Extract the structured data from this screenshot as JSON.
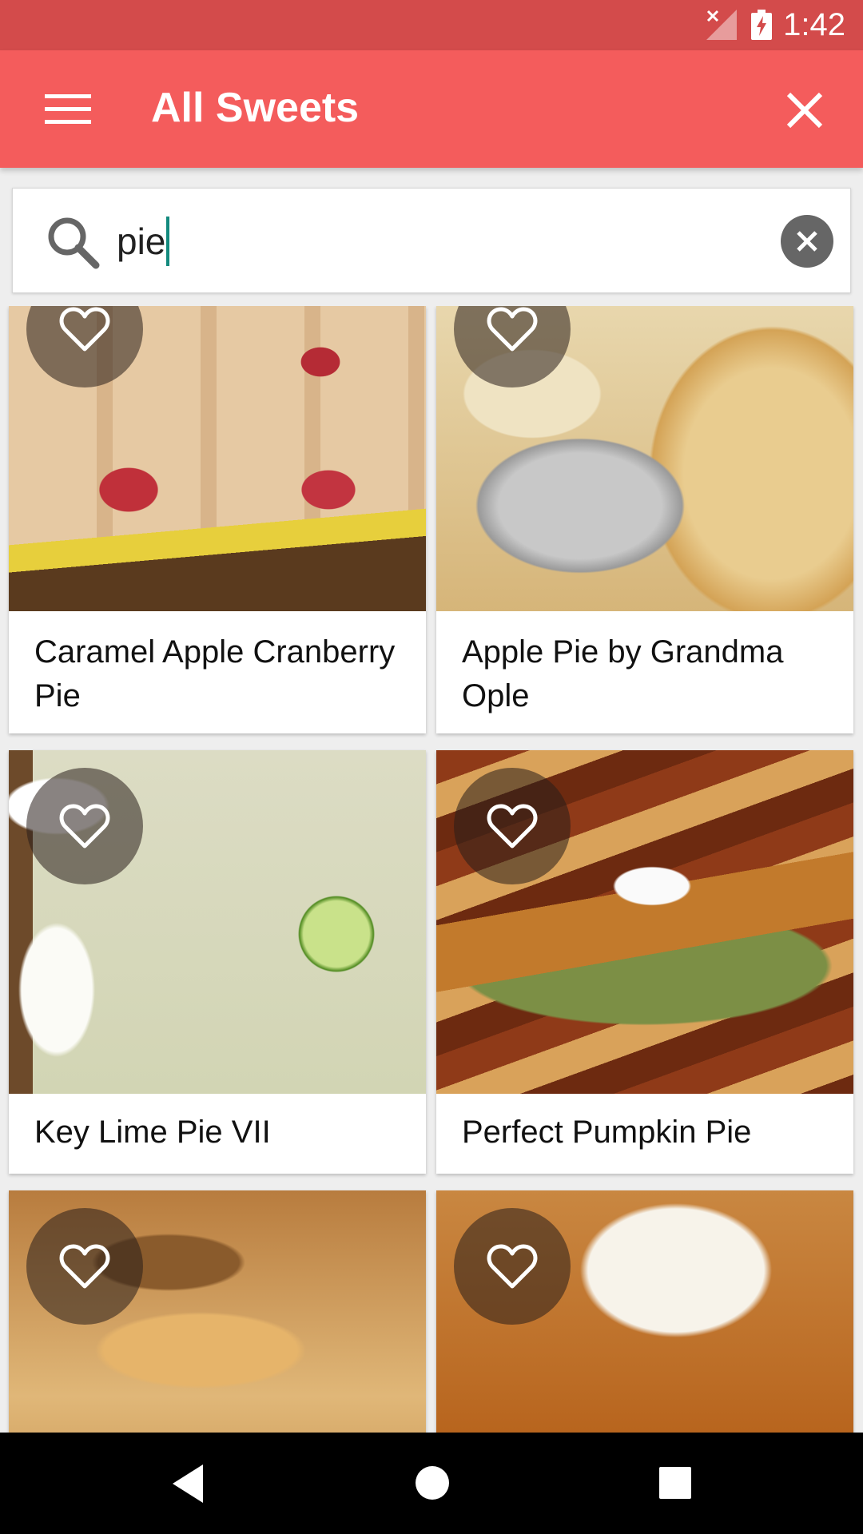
{
  "status_bar": {
    "time": "1:42"
  },
  "app_bar": {
    "title": "All Sweets"
  },
  "search": {
    "query": "pie"
  },
  "recipes": [
    {
      "title": "Caramel Apple Cranberry Pie"
    },
    {
      "title": "Apple Pie by Grandma Ople"
    },
    {
      "title": "Key Lime Pie VII"
    },
    {
      "title": "Perfect Pumpkin Pie"
    },
    {
      "title": ""
    },
    {
      "title": ""
    }
  ],
  "colors": {
    "status_bar": "#d34b4b",
    "app_bar": "#f45c5c",
    "caret": "#138a7e",
    "nav_bar": "#000000"
  },
  "icons": [
    "menu-icon",
    "close-icon",
    "search-icon",
    "clear-search-icon",
    "heart-outline-icon",
    "back-icon",
    "home-icon",
    "recents-icon"
  ]
}
